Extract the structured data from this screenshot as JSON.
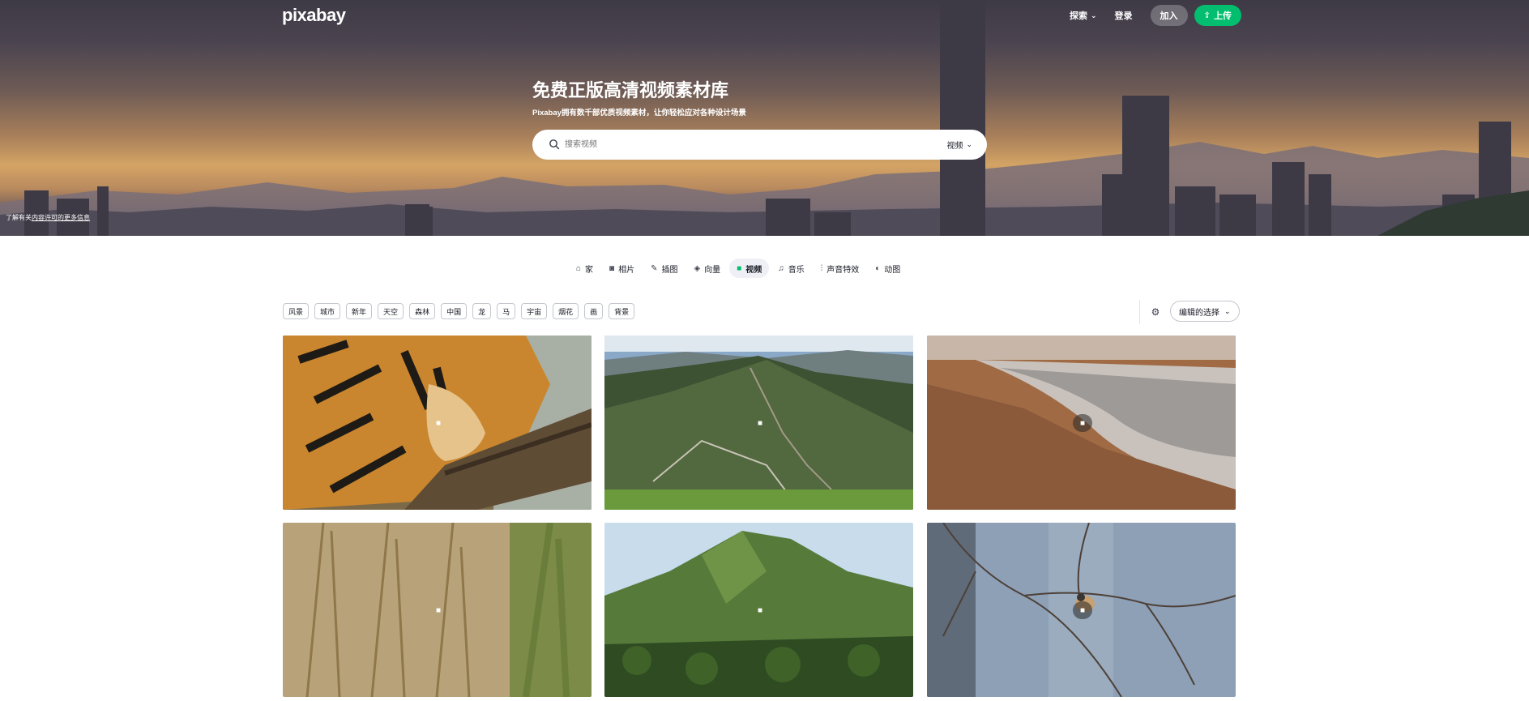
{
  "header": {
    "logo": "pixabay",
    "explore_label": "探索",
    "login_label": "登录",
    "join_label": "加入",
    "upload_label": "上传"
  },
  "hero": {
    "title": "免费正版高清视频素材库",
    "subtitle": "Pixabay拥有数千部优质视频素材，让你轻松应对各种设计场景",
    "search_placeholder": "搜索视频",
    "search_type": "视频",
    "credit_prefix": "了解有关",
    "credit_link": "内容许可的更多信息"
  },
  "categories": [
    {
      "label": "家",
      "icon": "home-icon",
      "glyph": "⌂",
      "active": false
    },
    {
      "label": "相片",
      "icon": "camera-icon",
      "glyph": "◙",
      "active": false
    },
    {
      "label": "插图",
      "icon": "brush-icon",
      "glyph": "✎",
      "active": false
    },
    {
      "label": "向量",
      "icon": "vector-icon",
      "glyph": "◈",
      "active": false
    },
    {
      "label": "视频",
      "icon": "video-icon",
      "glyph": "■",
      "active": true
    },
    {
      "label": "音乐",
      "icon": "music-icon",
      "glyph": "♫",
      "active": false
    },
    {
      "label": "声音特效",
      "icon": "soundwave-icon",
      "glyph": "⫶",
      "active": false
    },
    {
      "label": "动图",
      "icon": "gif-icon",
      "glyph": "◐",
      "active": false
    }
  ],
  "tags": [
    "风景",
    "城市",
    "新年",
    "天空",
    "森林",
    "中国",
    "龙",
    "马",
    "宇宙",
    "烟花",
    "画",
    "背景"
  ],
  "sort": {
    "label": "编辑的选择"
  },
  "colors": {
    "accent": "#02be6e",
    "text": "#191b26"
  },
  "videos": [
    {
      "subject": "tiger"
    },
    {
      "subject": "great-wall-mountains"
    },
    {
      "subject": "beach-waves"
    },
    {
      "subject": "grass"
    },
    {
      "subject": "green-mountain"
    },
    {
      "subject": "bird-on-branch"
    }
  ]
}
